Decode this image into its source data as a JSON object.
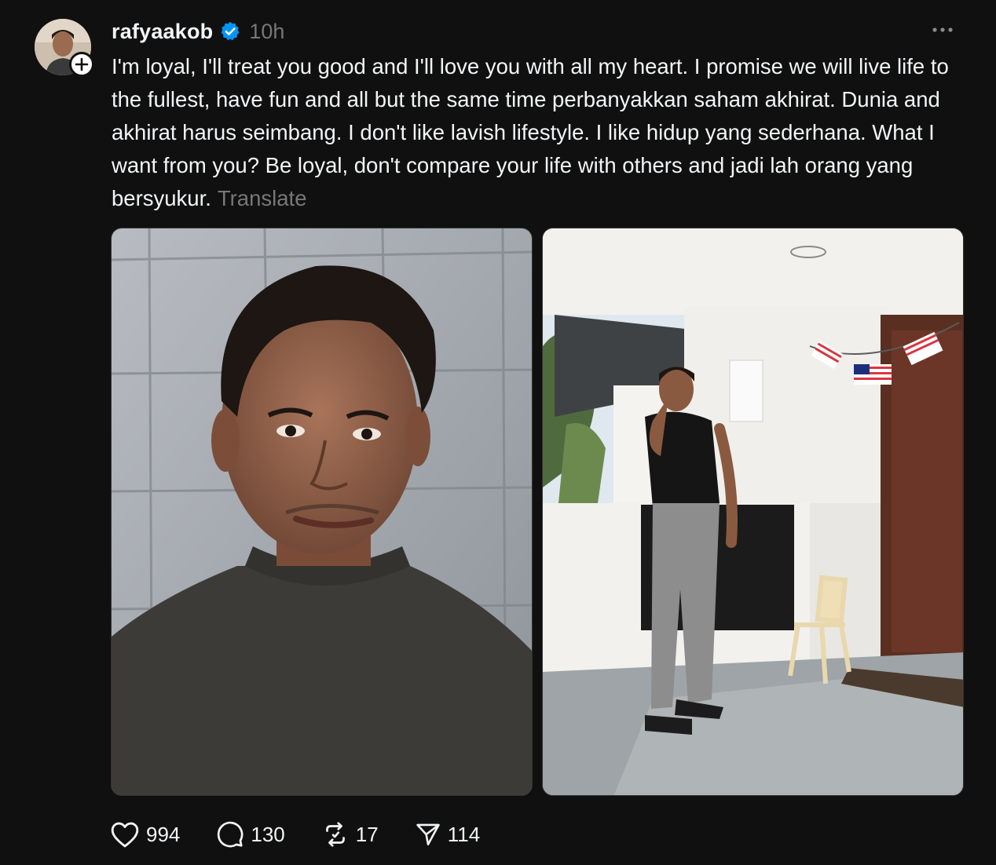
{
  "post": {
    "author": {
      "username": "rafyaakob",
      "verified_icon": "verified-badge-icon",
      "timestamp": "10h"
    },
    "caption": "I'm loyal, I'll treat you good and I'll love you with all my heart. I promise we will live life to the fullest, have fun and all but the same time perbanyakkan saham akhirat. Dunia and akhirat harus seimbang. I don't like lavish lifestyle. I like hidup yang sederhana. What I want from you? Be loyal, don't compare your life with others and jadi lah orang yang bersyukur.",
    "translate_label": "Translate",
    "media": [
      "selfie-photo",
      "balcony-photo"
    ],
    "actions": {
      "likes": "994",
      "replies": "130",
      "reposts": "17",
      "shares": "114"
    }
  },
  "colors": {
    "background": "#101010",
    "text": "#f3f5f7",
    "muted": "#777777",
    "verified": "#0095f6"
  }
}
